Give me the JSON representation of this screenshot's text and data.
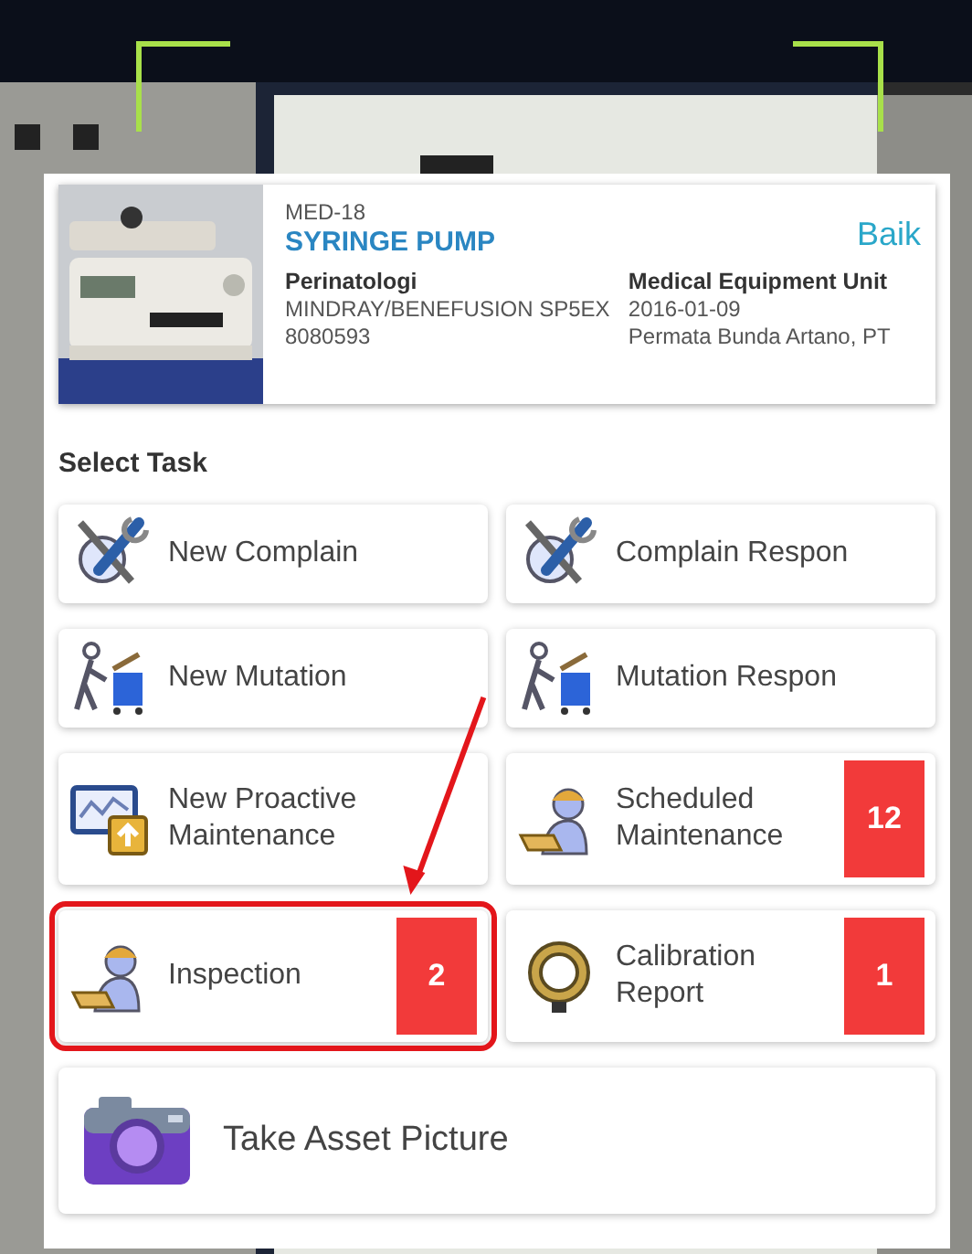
{
  "asset": {
    "code": "MED-18",
    "name": "SYRINGE PUMP",
    "status": "Baik",
    "department": "Perinatologi",
    "unit": "Medical Equipment Unit",
    "model": "MINDRAY/BENEFUSION SP5EX",
    "date": "2016-01-09",
    "serial": "8080593",
    "vendor": "Permata Bunda Artano, PT"
  },
  "section_title": "Select Task",
  "tasks": [
    {
      "label": "New Complain"
    },
    {
      "label": "Complain Respon"
    },
    {
      "label": "New Mutation"
    },
    {
      "label": "Mutation Respon"
    },
    {
      "label": "New Proactive Maintenance"
    },
    {
      "label": "Scheduled Maintenance",
      "count": "12"
    },
    {
      "label": "Inspection",
      "count": "2",
      "highlighted": true
    },
    {
      "label": "Calibration Report",
      "count": "1"
    },
    {
      "label": "Take Asset Picture",
      "wide": true
    }
  ]
}
